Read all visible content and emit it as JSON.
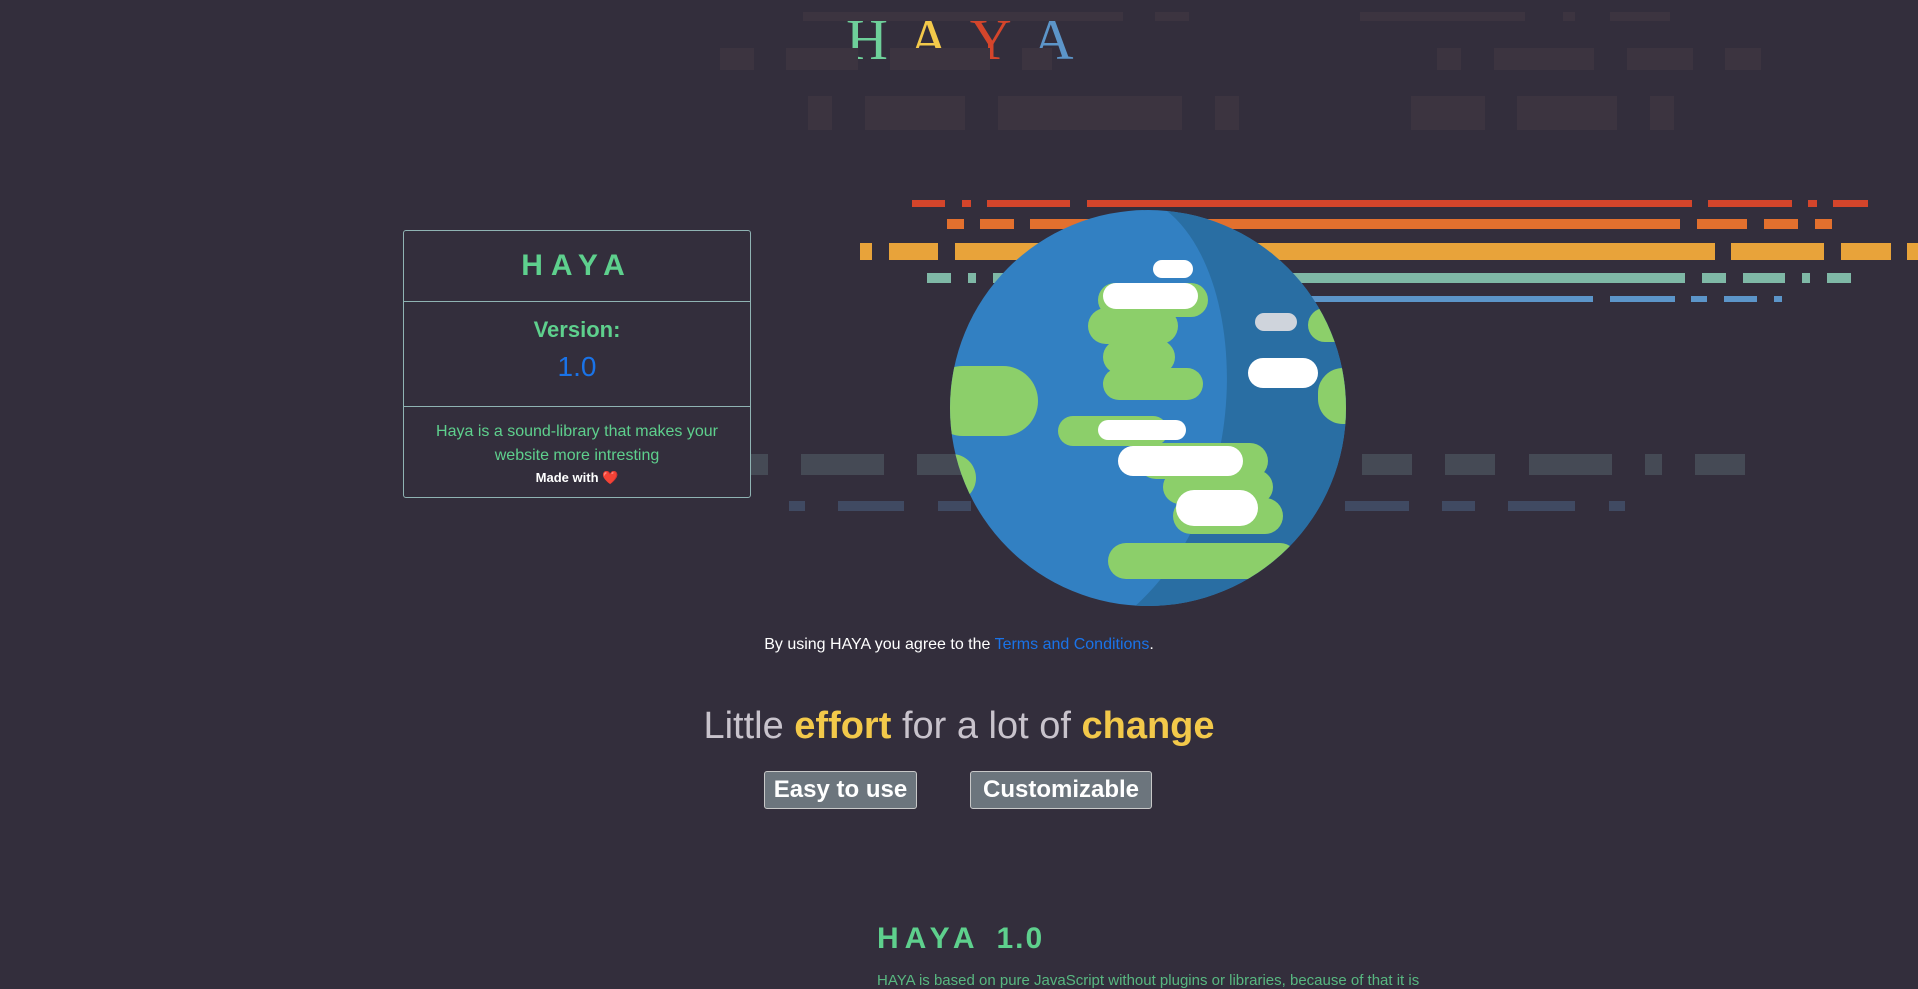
{
  "header": {
    "logo_letters": [
      {
        "char": "H",
        "color": "#6ed09a"
      },
      {
        "char": "A",
        "color": "#f3c94a"
      },
      {
        "char": "Y",
        "color": "#d4452b"
      },
      {
        "char": "A",
        "color": "#5c95c9"
      }
    ]
  },
  "info_card": {
    "title": "HAYA",
    "version_label": "Version:",
    "version_value": "1.0",
    "description": "Haya is a sound-library that makes your website more intresting",
    "made_with": "Made with ❤️"
  },
  "terms": {
    "prefix": "By using HAYA you agree to the ",
    "link_label": "Terms and Conditions",
    "suffix": "."
  },
  "tagline": {
    "w1": "Little ",
    "w2": "effort",
    "w3": " for a lot of ",
    "w4": "change"
  },
  "features": {
    "easy_label": "Easy to use",
    "custom_label": "Customizable"
  },
  "footer": {
    "title": "HAYA",
    "version": "1.0",
    "description": "HAYA is based on pure JavaScript without plugins or libraries, because of that it is"
  },
  "colors": {
    "background": "#332e3c",
    "green": "#5ed08d",
    "blue": "#1a73e8",
    "yellow": "#f3c94a",
    "red": "#d4452b",
    "orange": "#e2702e",
    "gold": "#e8a33a",
    "teal": "#7fb8a6",
    "light_blue": "#5c95c9"
  }
}
